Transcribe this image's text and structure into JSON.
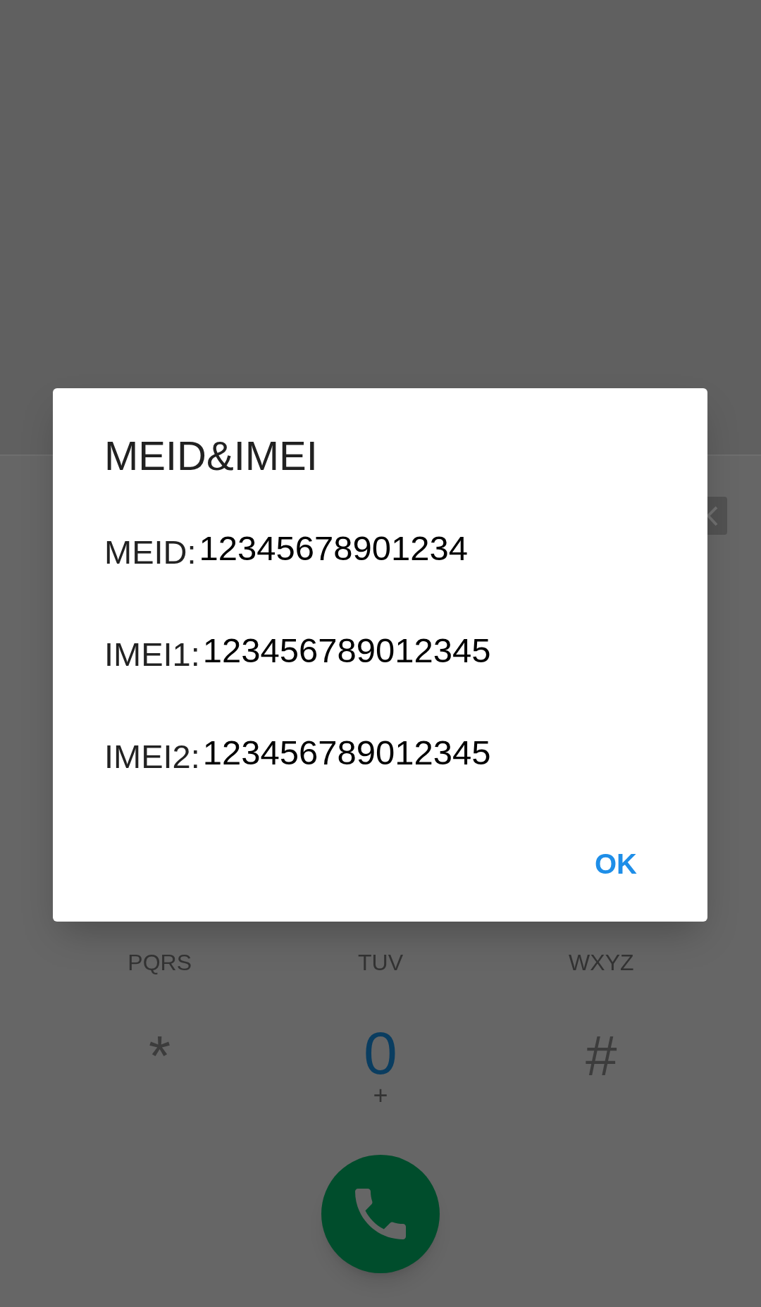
{
  "keypad": {
    "rows": [
      [
        {
          "kind": "letters",
          "text": "PQRS"
        },
        {
          "kind": "letters",
          "text": "TUV"
        },
        {
          "kind": "letters",
          "text": "WXYZ"
        }
      ],
      [
        {
          "kind": "symbol",
          "text": "*"
        },
        {
          "kind": "digit",
          "text": "0",
          "sub": "+"
        },
        {
          "kind": "symbol",
          "text": "#"
        }
      ]
    ]
  },
  "dialog": {
    "title": "MEID&IMEI",
    "rows": [
      {
        "label": "MEID:",
        "value": "12345678901234"
      },
      {
        "label": "IMEI1:",
        "value": "123456789012345"
      },
      {
        "label": "IMEI2:",
        "value": "123456789012345"
      }
    ],
    "buttons": [
      {
        "label": "OK"
      }
    ]
  }
}
